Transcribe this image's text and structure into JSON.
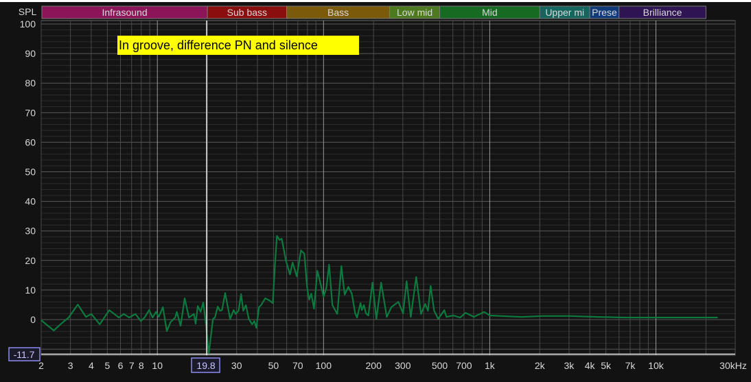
{
  "chart_data": {
    "type": "line",
    "title": "",
    "annotation": "In groove, difference PN and silence",
    "ylabel": "SPL",
    "xlabel": "",
    "x_unit": "Hz",
    "xscale": "log",
    "xlim": [
      2,
      30000
    ],
    "ylim": [
      -11.7,
      100
    ],
    "grid": true,
    "y_ticks": [
      100,
      90,
      80,
      70,
      60,
      50,
      40,
      30,
      20,
      10,
      0
    ],
    "y_min_readout": "-11.7",
    "x_ticks": [
      {
        "value": 2,
        "label": "2"
      },
      {
        "value": 3,
        "label": "3"
      },
      {
        "value": 4,
        "label": "4"
      },
      {
        "value": 5,
        "label": "5"
      },
      {
        "value": 6,
        "label": "6"
      },
      {
        "value": 7,
        "label": "7"
      },
      {
        "value": 8,
        "label": "8"
      },
      {
        "value": 10,
        "label": "10"
      },
      {
        "value": 30,
        "label": "30"
      },
      {
        "value": 50,
        "label": "50"
      },
      {
        "value": 70,
        "label": "70"
      },
      {
        "value": 100,
        "label": "100"
      },
      {
        "value": 200,
        "label": "200"
      },
      {
        "value": 300,
        "label": "300"
      },
      {
        "value": 500,
        "label": "500"
      },
      {
        "value": 700,
        "label": "700"
      },
      {
        "value": 1000,
        "label": "1k"
      },
      {
        "value": 2000,
        "label": "2k"
      },
      {
        "value": 3000,
        "label": "3k"
      },
      {
        "value": 4000,
        "label": "4k"
      },
      {
        "value": 5000,
        "label": "5k"
      },
      {
        "value": 7000,
        "label": "7k"
      },
      {
        "value": 10000,
        "label": "10k"
      },
      {
        "value": 30000,
        "label": "30kHz"
      }
    ],
    "cursor": {
      "value": 19.8,
      "label": "19.8"
    },
    "bands": [
      {
        "name": "Infrasound",
        "from": 2,
        "to": 20,
        "color": "#8c1559"
      },
      {
        "name": "Sub bass",
        "from": 20,
        "to": 60,
        "color": "#8a0e0e"
      },
      {
        "name": "Bass",
        "from": 60,
        "to": 250,
        "color": "#7b5a0b"
      },
      {
        "name": "Low mid",
        "from": 250,
        "to": 500,
        "color": "#4e7a1f"
      },
      {
        "name": "Mid",
        "from": 500,
        "to": 2000,
        "color": "#166a22"
      },
      {
        "name": "Upper mi",
        "from": 2000,
        "to": 4000,
        "color": "#14665e"
      },
      {
        "name": "Prese",
        "from": 4000,
        "to": 6000,
        "color": "#113a78"
      },
      {
        "name": "Brilliance",
        "from": 6000,
        "to": 20000,
        "color": "#2e1452"
      }
    ],
    "series": [
      {
        "name": "difference",
        "color": "#0c7a3e",
        "points": [
          [
            2.0,
            -0.2
          ],
          [
            2.38,
            -3.7
          ],
          [
            2.61,
            -1.6
          ],
          [
            2.93,
            0.7
          ],
          [
            3.32,
            5.1
          ],
          [
            3.72,
            0.9
          ],
          [
            4.01,
            1.9
          ],
          [
            4.5,
            -1.6
          ],
          [
            5.14,
            3.2
          ],
          [
            5.87,
            0.7
          ],
          [
            6.28,
            1.9
          ],
          [
            6.77,
            0.7
          ],
          [
            7.38,
            1.9
          ],
          [
            7.96,
            -0.5
          ],
          [
            8.43,
            0.9
          ],
          [
            8.92,
            3.2
          ],
          [
            9.36,
            0.7
          ],
          [
            9.81,
            2.6
          ],
          [
            10.2,
            0.9
          ],
          [
            10.8,
            4.2
          ],
          [
            11.4,
            -3.9
          ],
          [
            12.0,
            -0.9
          ],
          [
            12.8,
            0.7
          ],
          [
            13.1,
            2.6
          ],
          [
            13.8,
            -2.1
          ],
          [
            14.6,
            7.2
          ],
          [
            15.5,
            0.7
          ],
          [
            16.6,
            1.9
          ],
          [
            17.0,
            -1.4
          ],
          [
            17.5,
            4.6
          ],
          [
            18.2,
            2.6
          ],
          [
            18.9,
            5.8
          ],
          [
            19.6,
            -1.6
          ],
          [
            20.4,
            -11.4
          ],
          [
            21.6,
            0.2
          ],
          [
            22.2,
            0.7
          ],
          [
            23.1,
            4.4
          ],
          [
            23.8,
            3.0
          ],
          [
            24.5,
            3.2
          ],
          [
            25.6,
            9.0
          ],
          [
            27.4,
            0.2
          ],
          [
            28.8,
            3.2
          ],
          [
            29.6,
            1.9
          ],
          [
            30.8,
            3.0
          ],
          [
            31.9,
            8.6
          ],
          [
            32.9,
            3.0
          ],
          [
            34.1,
            4.9
          ],
          [
            35.5,
            0.2
          ],
          [
            37.2,
            -1.6
          ],
          [
            38.3,
            -0.5
          ],
          [
            39.4,
            -2.8
          ],
          [
            40.9,
            4.2
          ],
          [
            42.1,
            4.9
          ],
          [
            44.6,
            7.2
          ],
          [
            47.2,
            6.5
          ],
          [
            49.5,
            5.6
          ],
          [
            50.9,
            17.6
          ],
          [
            52.4,
            28.3
          ],
          [
            54.4,
            26.9
          ],
          [
            56.0,
            27.4
          ],
          [
            57.6,
            23.9
          ],
          [
            59.3,
            20.0
          ],
          [
            62.8,
            15.3
          ],
          [
            65.2,
            19.3
          ],
          [
            69.0,
            14.6
          ],
          [
            73.1,
            23.4
          ],
          [
            76.6,
            22.3
          ],
          [
            79.6,
            11.1
          ],
          [
            81.9,
            6.7
          ],
          [
            84.3,
            8.8
          ],
          [
            87.6,
            3.7
          ],
          [
            91.8,
            16.5
          ],
          [
            94.5,
            13.7
          ],
          [
            100,
            7.7
          ],
          [
            104,
            10.7
          ],
          [
            108,
            18.6
          ],
          [
            113,
            4.9
          ],
          [
            121,
            1.9
          ],
          [
            128,
            18.1
          ],
          [
            134,
            8.4
          ],
          [
            141,
            11.1
          ],
          [
            148,
            8.8
          ],
          [
            155,
            2.1
          ],
          [
            159,
            0.7
          ],
          [
            167,
            5.6
          ],
          [
            170,
            3.2
          ],
          [
            175,
            4.9
          ],
          [
            180,
            2.1
          ],
          [
            186,
            1.4
          ],
          [
            197,
            12.5
          ],
          [
            208,
            0.2
          ],
          [
            222,
            12.5
          ],
          [
            240,
            0.9
          ],
          [
            256,
            4.2
          ],
          [
            282,
            6.0
          ],
          [
            301,
            2.1
          ],
          [
            316,
            13.0
          ],
          [
            335,
            0.9
          ],
          [
            361,
            14.4
          ],
          [
            386,
            1.9
          ],
          [
            409,
            5.3
          ],
          [
            425,
            3.0
          ],
          [
            441,
            11.4
          ],
          [
            463,
            3.0
          ],
          [
            490,
            0.2
          ],
          [
            533,
            3.2
          ],
          [
            549,
            0.9
          ],
          [
            604,
            1.4
          ],
          [
            664,
            0.7
          ],
          [
            716,
            2.3
          ],
          [
            803,
            0.9
          ],
          [
            927,
            2.6
          ],
          [
            1000,
            1.4
          ],
          [
            1175,
            1.2
          ],
          [
            1563,
            0.9
          ],
          [
            2080,
            1.2
          ],
          [
            3040,
            1.2
          ],
          [
            4460,
            0.9
          ],
          [
            6520,
            0.7
          ],
          [
            10000,
            0.7
          ],
          [
            15350,
            0.7
          ],
          [
            23550,
            0.7
          ]
        ]
      }
    ]
  }
}
